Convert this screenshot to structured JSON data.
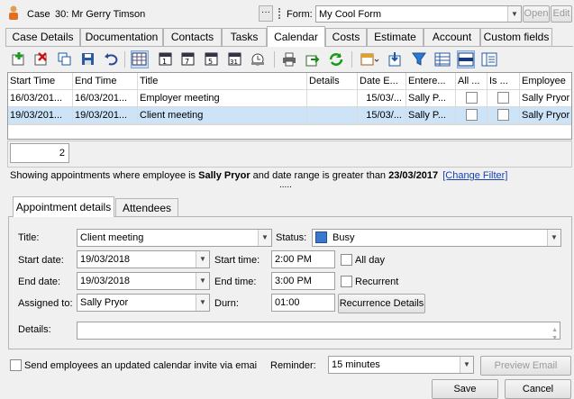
{
  "header": {
    "case_label": "Case",
    "case_value": "30: Mr Gerry Timson",
    "more_label": "···",
    "form_label": "Form:",
    "form_value": "My Cool Form",
    "open_label": "Open",
    "edit_label": "Edit"
  },
  "tabs": [
    {
      "label": "Case Details"
    },
    {
      "label": "Documentation"
    },
    {
      "label": "Contacts"
    },
    {
      "label": "Tasks"
    },
    {
      "label": "Calendar",
      "active": true
    },
    {
      "label": "Costs"
    },
    {
      "label": "Estimate"
    },
    {
      "label": "Account"
    },
    {
      "label": "Custom fields"
    }
  ],
  "toolbar_icons": [
    "add-icon",
    "delete-icon",
    "copy-icon",
    "save-icon",
    "undo-icon",
    "calendar-grid-icon",
    "calendar-day-icon",
    "calendar-week-icon",
    "calendar-workweek-icon",
    "calendar-month-icon",
    "calendar-clock-icon",
    "print-icon",
    "export-icon",
    "refresh-icon",
    "calendar-options-icon",
    "import-icon",
    "filter-icon",
    "table-view-icon",
    "split-view-icon",
    "detail-view-icon"
  ],
  "grid": {
    "columns": [
      "Start Time",
      "End Time",
      "Title",
      "Details",
      "Date E...",
      "Entere...",
      "All ...",
      "Is ...",
      "Employee"
    ],
    "rows": [
      {
        "start": "16/03/201...",
        "end": "16/03/201...",
        "title": "Employer meeting",
        "details": "",
        "date_e": "15/03/...",
        "entered": "Sally P...",
        "all_day": false,
        "is_x": false,
        "employee": "Sally Pryor",
        "selected": false
      },
      {
        "start": "19/03/201...",
        "end": "19/03/201...",
        "title": "Client meeting",
        "details": "",
        "date_e": "15/03/...",
        "entered": "Sally P...",
        "all_day": false,
        "is_x": false,
        "employee": "Sally Pryor",
        "selected": true
      }
    ],
    "count": "2"
  },
  "filter": {
    "text_prefix": "Showing appointments where employee is ",
    "employee": "Sally Pryor",
    "text_mid": " and date range is greater than ",
    "date": "23/03/2017",
    "change_link": "[Change Filter]",
    "splitter": "....."
  },
  "subtabs": [
    {
      "label": "Appointment details",
      "active": true
    },
    {
      "label": "Attendees"
    }
  ],
  "form": {
    "title_label": "Title:",
    "title_value": "Client meeting",
    "status_label": "Status:",
    "status_value": "Busy",
    "status_color": "#3a78d0",
    "start_date_label": "Start date:",
    "start_date_value": "19/03/2018",
    "start_time_label": "Start time:",
    "start_time_value": "2:00 PM",
    "all_day_label": "All day",
    "end_date_label": "End date:",
    "end_date_value": "19/03/2018",
    "end_time_label": "End time:",
    "end_time_value": "3:00 PM",
    "recurrent_label": "Recurrent",
    "assigned_label": "Assigned to:",
    "assigned_value": "Sally Pryor",
    "durn_label": "Durn:",
    "durn_value": "01:00",
    "recurrence_button": "Recurrence Details",
    "details_label": "Details:",
    "details_value": ""
  },
  "footer": {
    "invite_label": "Send employees an updated calendar invite via emai",
    "reminder_label": "Reminder:",
    "reminder_value": "15 minutes",
    "preview_button": "Preview Email",
    "save_button": "Save",
    "cancel_button": "Cancel"
  }
}
